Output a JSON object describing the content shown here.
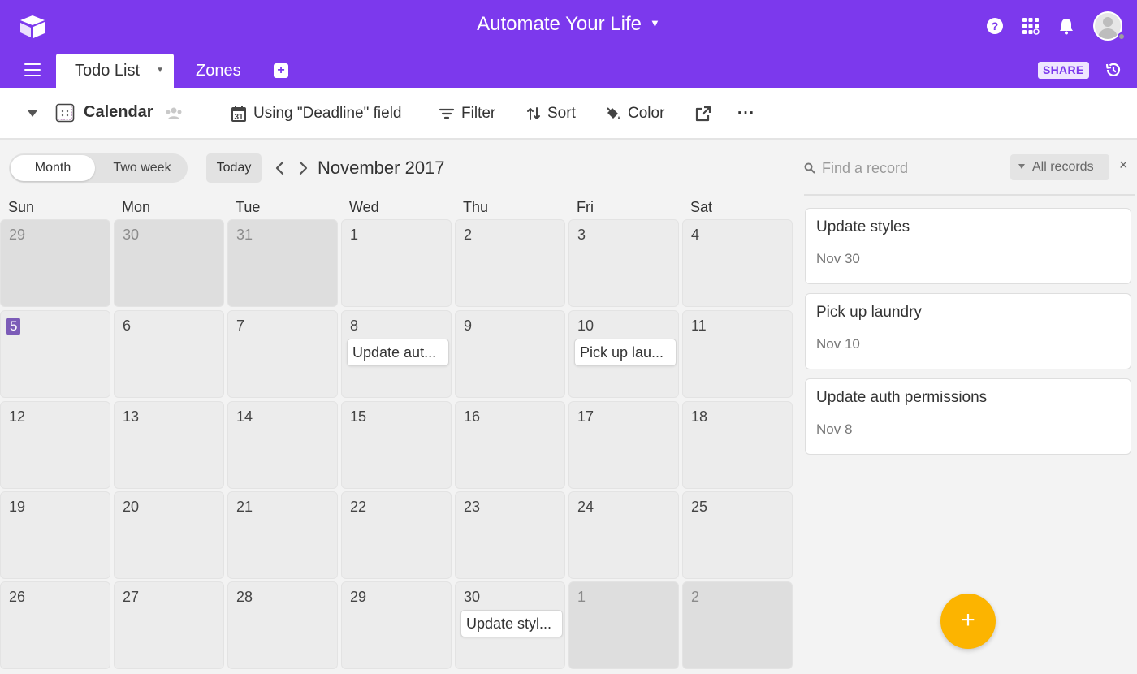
{
  "app": {
    "base_title": "Automate Your Life",
    "accent_color": "#7c39ed",
    "icons": [
      "logo-icon",
      "help-icon",
      "apps-grid-icon",
      "bell-icon",
      "avatar"
    ]
  },
  "tabs": {
    "items": [
      {
        "label": "Todo List",
        "active": true
      },
      {
        "label": "Zones",
        "active": false
      }
    ],
    "share_label": "SHARE"
  },
  "viewbar": {
    "view_name": "Calendar",
    "using_field": "Using \"Deadline\" field",
    "filter": "Filter",
    "sort": "Sort",
    "color": "Color",
    "more": "···"
  },
  "calendar": {
    "mode_month": "Month",
    "mode_two_week": "Two week",
    "today": "Today",
    "month_title": "November 2017",
    "days_of_week": [
      "Sun",
      "Mon",
      "Tue",
      "Wed",
      "Thu",
      "Fri",
      "Sat"
    ],
    "weeks": [
      [
        "29",
        "30",
        "31",
        "1",
        "2",
        "3",
        "4"
      ],
      [
        "5",
        "6",
        "7",
        "8",
        "9",
        "10",
        "11"
      ],
      [
        "12",
        "13",
        "14",
        "15",
        "16",
        "17",
        "18"
      ],
      [
        "19",
        "20",
        "21",
        "22",
        "23",
        "24",
        "25"
      ],
      [
        "26",
        "27",
        "28",
        "29",
        "30",
        "1",
        "2"
      ]
    ],
    "events": {
      "nov8": "Update aut...",
      "nov10": "Pick up lau...",
      "nov30": "Update styl..."
    },
    "today_date": "5"
  },
  "sidebar": {
    "search_placeholder": "Find a record",
    "filter_label": "All records",
    "close": "×",
    "records": [
      {
        "title": "Update styles",
        "date": "Nov 30"
      },
      {
        "title": "Pick up laundry",
        "date": "Nov 10"
      },
      {
        "title": "Update auth permissions",
        "date": "Nov 8"
      }
    ],
    "fab": "+"
  }
}
